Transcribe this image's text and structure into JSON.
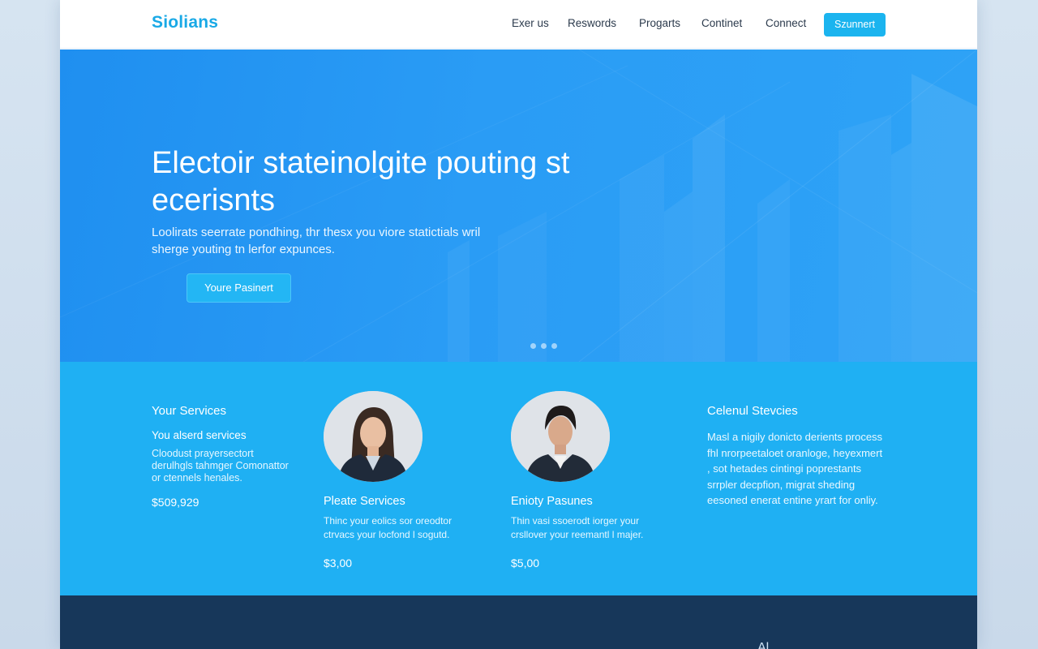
{
  "brand": {
    "logo": "Siolians",
    "accent": "#19a9e6"
  },
  "nav": {
    "items": [
      "Exer us",
      "Reswords",
      "Progarts",
      "Continet",
      "Connect"
    ],
    "cta": "Szunnert"
  },
  "hero": {
    "title": "Electoir stateinolgite pouting st ecerisnts",
    "text": "Loolirats seerrate pondhing, thr thesx you viore statictials wril sherge youting tn lerfor expunces.",
    "button": "Youre Pasinert",
    "slides": 3
  },
  "services": {
    "left": {
      "title": "Your Services",
      "subtitle": "You alserd services",
      "desc": "Cloodust prayersectort derulhgls tahmger Comonattor or ctennels henales.",
      "price": "$509,929"
    },
    "cards": [
      {
        "title": "Pleate Services",
        "desc": "Thinc your eolics sor oreodtor ctrvacs your locfond l sogutd.",
        "price": "$3,00"
      },
      {
        "title": "Enioty Pasunes",
        "desc": "Thin vasi ssoerodt iorger your crsllover your reemantl l majer.",
        "price": "$5,00"
      }
    ],
    "right": {
      "title": "Celenul Stevcies",
      "desc": "Masl a nigily donicto derients process fhl nrorpeetaloet oranloge, heyexmert , sot hetades cintingi poprestants srrpler decpfion, migrat sheding eesoned enerat entine yrart for onliy."
    }
  },
  "footer": {
    "mark": "Al"
  },
  "colors": {
    "hero": "#2a9cf5",
    "services": "#1fb0f3",
    "footer": "#17375a",
    "cta": "#1bb4ef"
  }
}
